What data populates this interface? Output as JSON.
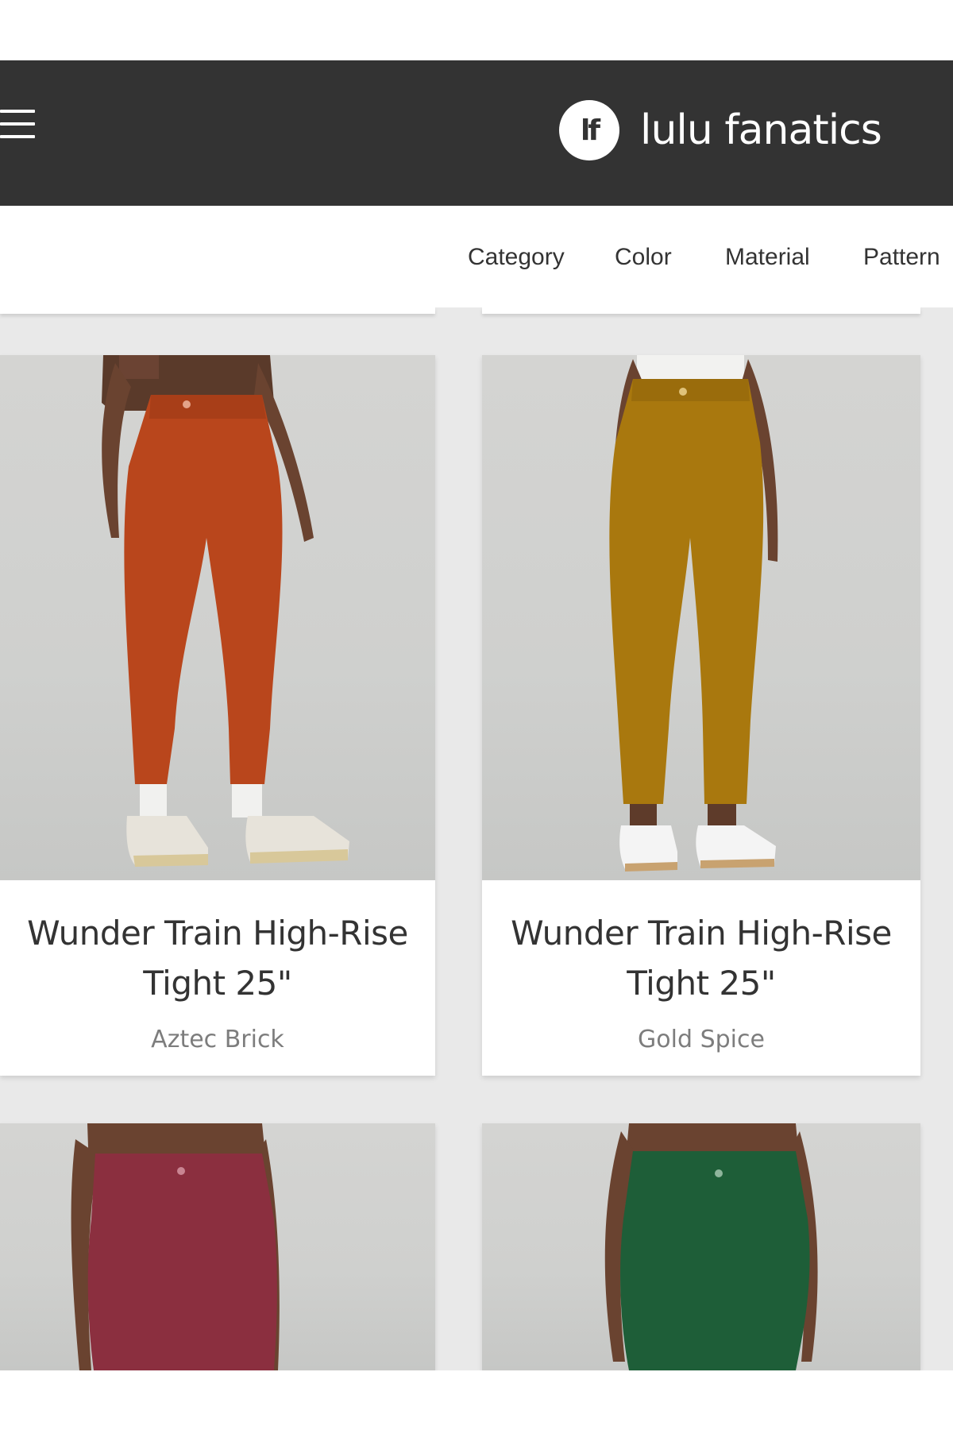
{
  "header": {
    "logo_text": "lf",
    "site_name": "lulu fanatics",
    "background_color": "#333333"
  },
  "filters": [
    "Category",
    "Color",
    "Material",
    "Pattern"
  ],
  "products": [
    {
      "title_line1": "Wunder Train High-Rise",
      "title_line2": "Tight 25\"",
      "color_name": "Aztec Brick",
      "swatch": "#b9461c"
    },
    {
      "title_line1": "Wunder Train High-Rise",
      "title_line2": "Tight 25\"",
      "color_name": "Gold Spice",
      "swatch": "#a9780e"
    },
    {
      "swatch": "#8b2f3f"
    },
    {
      "swatch": "#1e5e38"
    }
  ]
}
